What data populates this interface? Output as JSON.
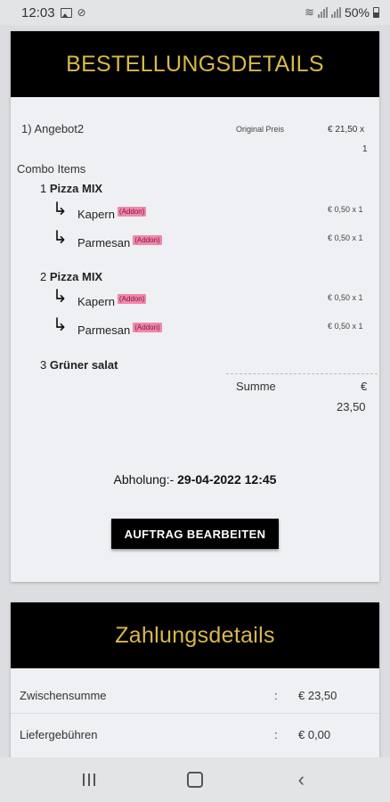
{
  "status_bar": {
    "time": "12:03",
    "battery": "50%"
  },
  "order": {
    "title": "BESTELLUNGSDETAILS",
    "offer": "1) Angebot2",
    "original_label": "Original Preis",
    "original_price": "€ 21,50 x",
    "original_qty": "1",
    "combo_label": "Combo Items",
    "items": [
      {
        "num": "1",
        "name": "Pizza MIX",
        "addons": [
          {
            "name": "Kapern",
            "badge": "(Addon)",
            "price": "€ 0,50 x 1"
          },
          {
            "name": "Parmesan",
            "badge": "(Addon)",
            "price": "€ 0,50 x 1"
          }
        ]
      },
      {
        "num": "2",
        "name": "Pizza MIX",
        "addons": [
          {
            "name": "Kapern",
            "badge": "(Addon)",
            "price": "€ 0,50 x 1"
          },
          {
            "name": "Parmesan",
            "badge": "(Addon)",
            "price": "€ 0,50 x 1"
          }
        ]
      },
      {
        "num": "3",
        "name": "Grüner salat",
        "addons": []
      }
    ],
    "sum_label": "Summe",
    "sum_currency": "€",
    "sum_value": "23,50",
    "pickup_label": "Abholung:-",
    "pickup_value": "29-04-2022 12:45",
    "edit_button": "AUFTRAG BEARBEITEN"
  },
  "payment": {
    "title": "Zahlungsdetails",
    "rows": [
      {
        "label": "Zwischensumme",
        "colon": ":",
        "value": "€ 23,50"
      },
      {
        "label": "Liefergebühren",
        "colon": ":",
        "value": "€ 0,00"
      }
    ]
  },
  "colors": {
    "header_bg": "#000000",
    "header_text": "#d8b84a",
    "addon_badge_bg": "#ee88aa",
    "card_bg": "#eef0f3"
  }
}
